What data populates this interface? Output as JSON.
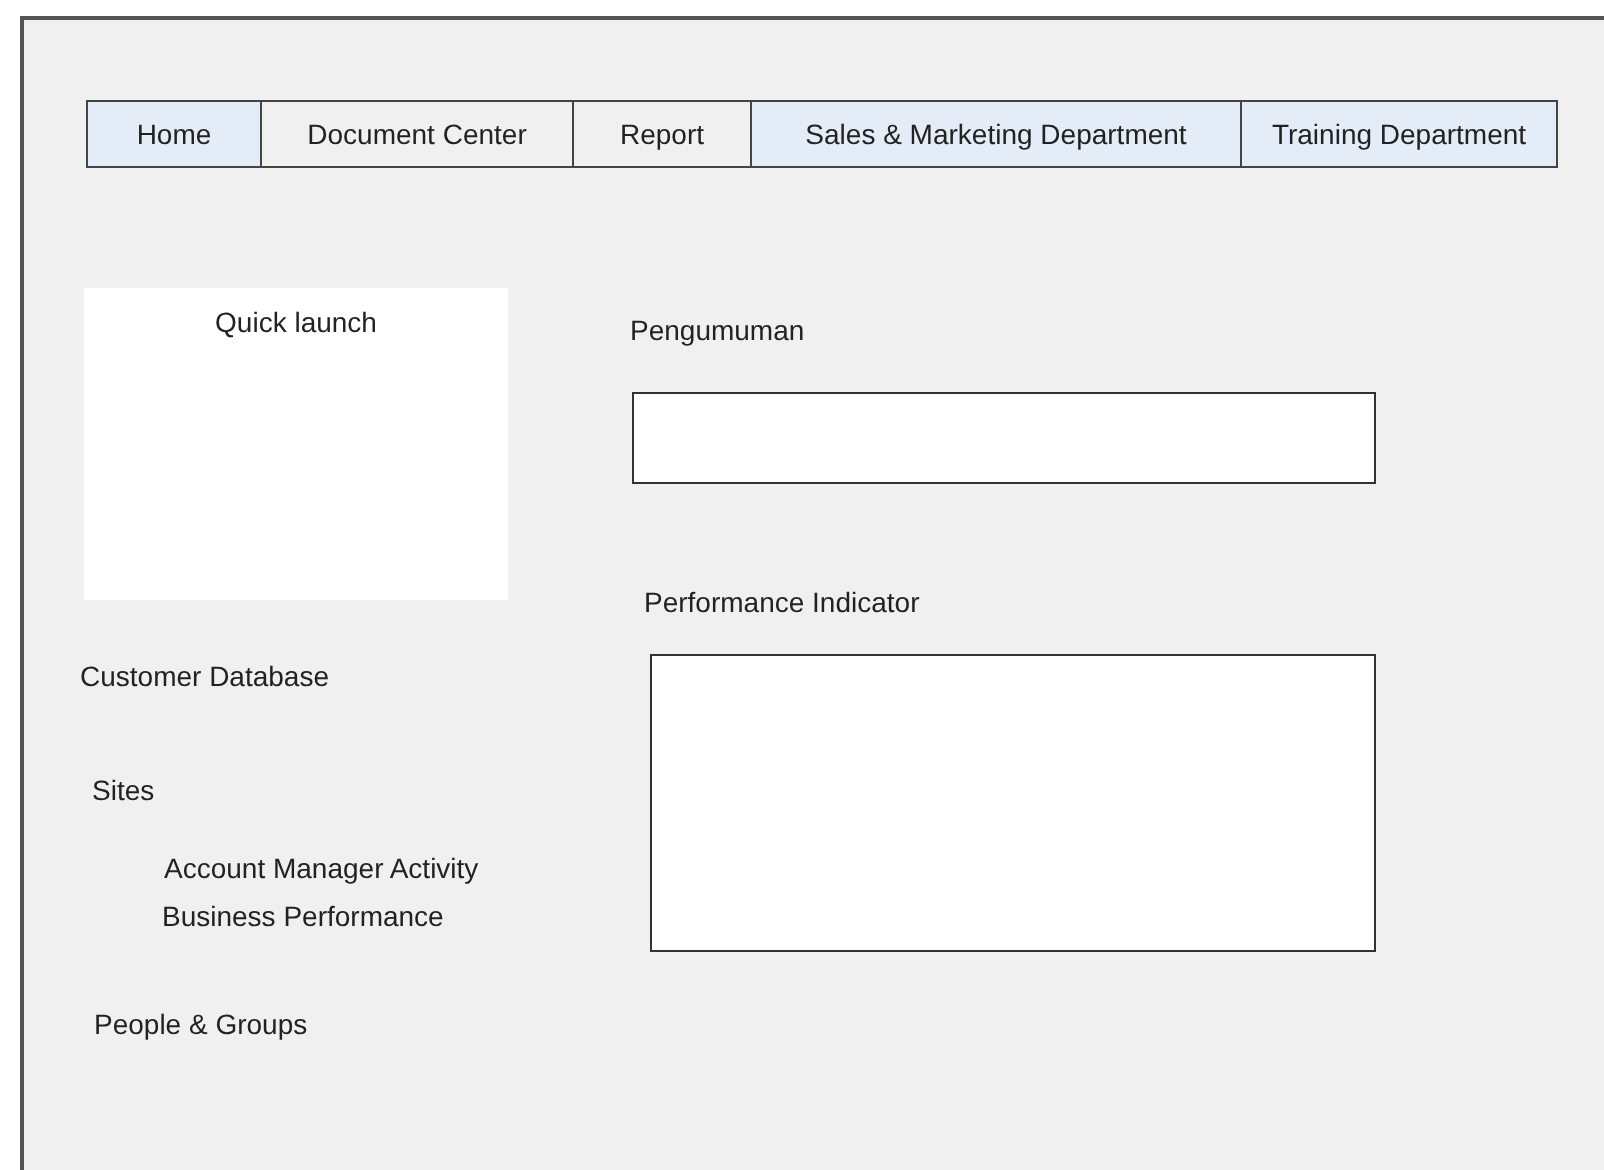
{
  "tabs": [
    {
      "label": "Home",
      "highlighted": true
    },
    {
      "label": "Document Center",
      "highlighted": false
    },
    {
      "label": "Report",
      "highlighted": false
    },
    {
      "label": "Sales & Marketing Department",
      "highlighted": true
    },
    {
      "label": "Training Department",
      "highlighted": true
    }
  ],
  "sidebar": {
    "quick_launch": {
      "title": "Quick launch"
    },
    "links": [
      {
        "label": "Customer Database"
      },
      {
        "label": "Sites",
        "children": [
          {
            "label": "Account Manager Activity"
          },
          {
            "label": "Business Performance"
          }
        ]
      },
      {
        "label": "People & Groups"
      }
    ]
  },
  "announcements": {
    "title": "Pengumuman"
  },
  "performance": {
    "title": "Performance Indicator"
  }
}
